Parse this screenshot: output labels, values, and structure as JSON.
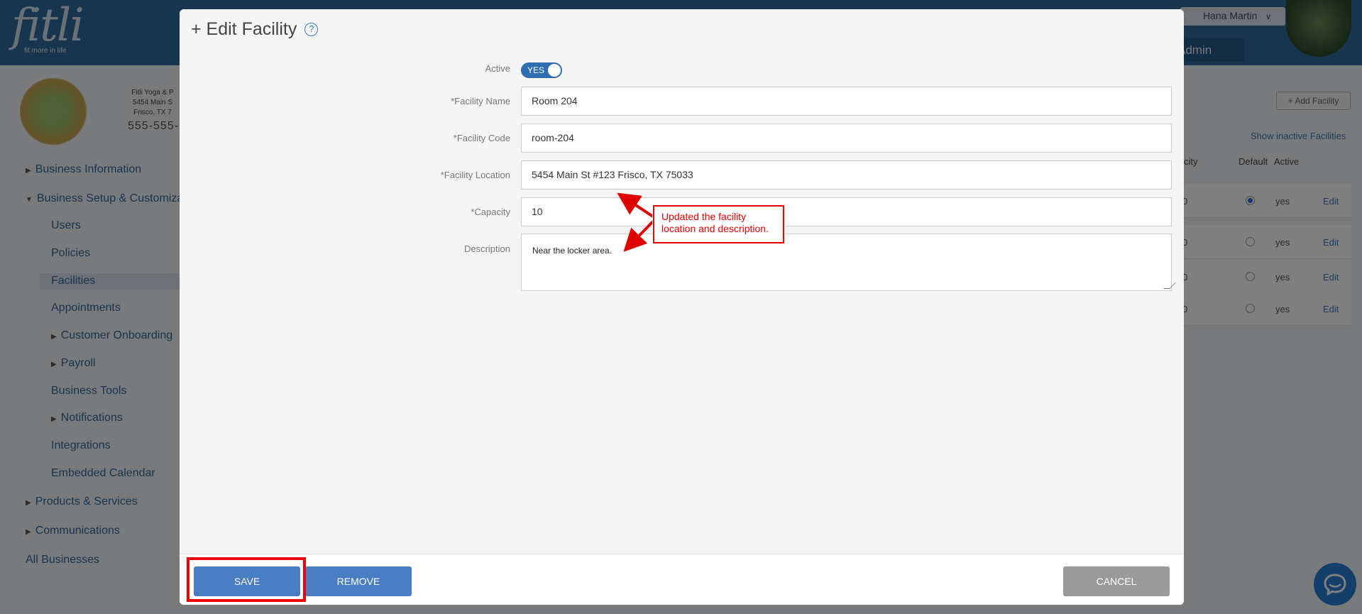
{
  "app": {
    "logo_text": "fitli",
    "logo_tagline": "fit more in life",
    "user_name": "Hana Martin",
    "admin_tab": "Admin"
  },
  "business": {
    "name": "Fitli Yoga & P",
    "address_line1": "5454 Main S",
    "address_line2": "Frisco, TX 7",
    "phone": "555-555-"
  },
  "sidebar": {
    "items": [
      {
        "label": "Business Information"
      },
      {
        "label": "Business Setup & Customiza"
      },
      {
        "label": "Users"
      },
      {
        "label": "Policies"
      },
      {
        "label": "Facilities"
      },
      {
        "label": "Appointments"
      },
      {
        "label": "Customer Onboarding"
      },
      {
        "label": "Payroll"
      },
      {
        "label": "Business Tools"
      },
      {
        "label": "Notifications"
      },
      {
        "label": "Integrations"
      },
      {
        "label": "Embedded Calendar"
      },
      {
        "label": "Products & Services"
      },
      {
        "label": "Communications"
      },
      {
        "label": "All Businesses"
      }
    ]
  },
  "facilities_page": {
    "add_button": "+ Add Facility",
    "show_inactive": "Show inactive Facilities",
    "columns": [
      "city",
      "Default",
      "Active"
    ],
    "rows": [
      {
        "capacity": "0",
        "default": true,
        "active": "yes",
        "action": "Edit"
      },
      {
        "capacity": "0",
        "default": false,
        "active": "yes",
        "action": "Edit"
      },
      {
        "capacity": "0",
        "default": false,
        "active": "yes",
        "action": "Edit"
      },
      {
        "capacity": "0",
        "default": false,
        "active": "yes",
        "action": "Edit"
      }
    ]
  },
  "modal": {
    "title": "+ Edit Facility",
    "help_icon": "?",
    "fields": {
      "active_label": "Active",
      "active_value": "YES",
      "name_label": "*Facility Name",
      "name_value": "Room 204",
      "code_label": "*Facility Code",
      "code_value": "room-204",
      "location_label": "*Facility Location",
      "location_value": "5454 Main St #123 Frisco, TX 75033",
      "capacity_label": "*Capacity",
      "capacity_value": "10",
      "description_label": "Description",
      "description_value": "Near the locker area."
    },
    "buttons": {
      "save": "SAVE",
      "remove": "REMOVE",
      "cancel": "CANCEL"
    }
  },
  "annotation": {
    "callout_line1": "Updated the facility",
    "callout_line2": "location and description.",
    "color": "#e00000"
  },
  "icons": {
    "help": "question-circle-icon",
    "chat": "chat-bubble-icon",
    "chevron": "chevron-down-icon",
    "caret_right": "caret-right-icon",
    "caret_down": "caret-down-icon"
  }
}
